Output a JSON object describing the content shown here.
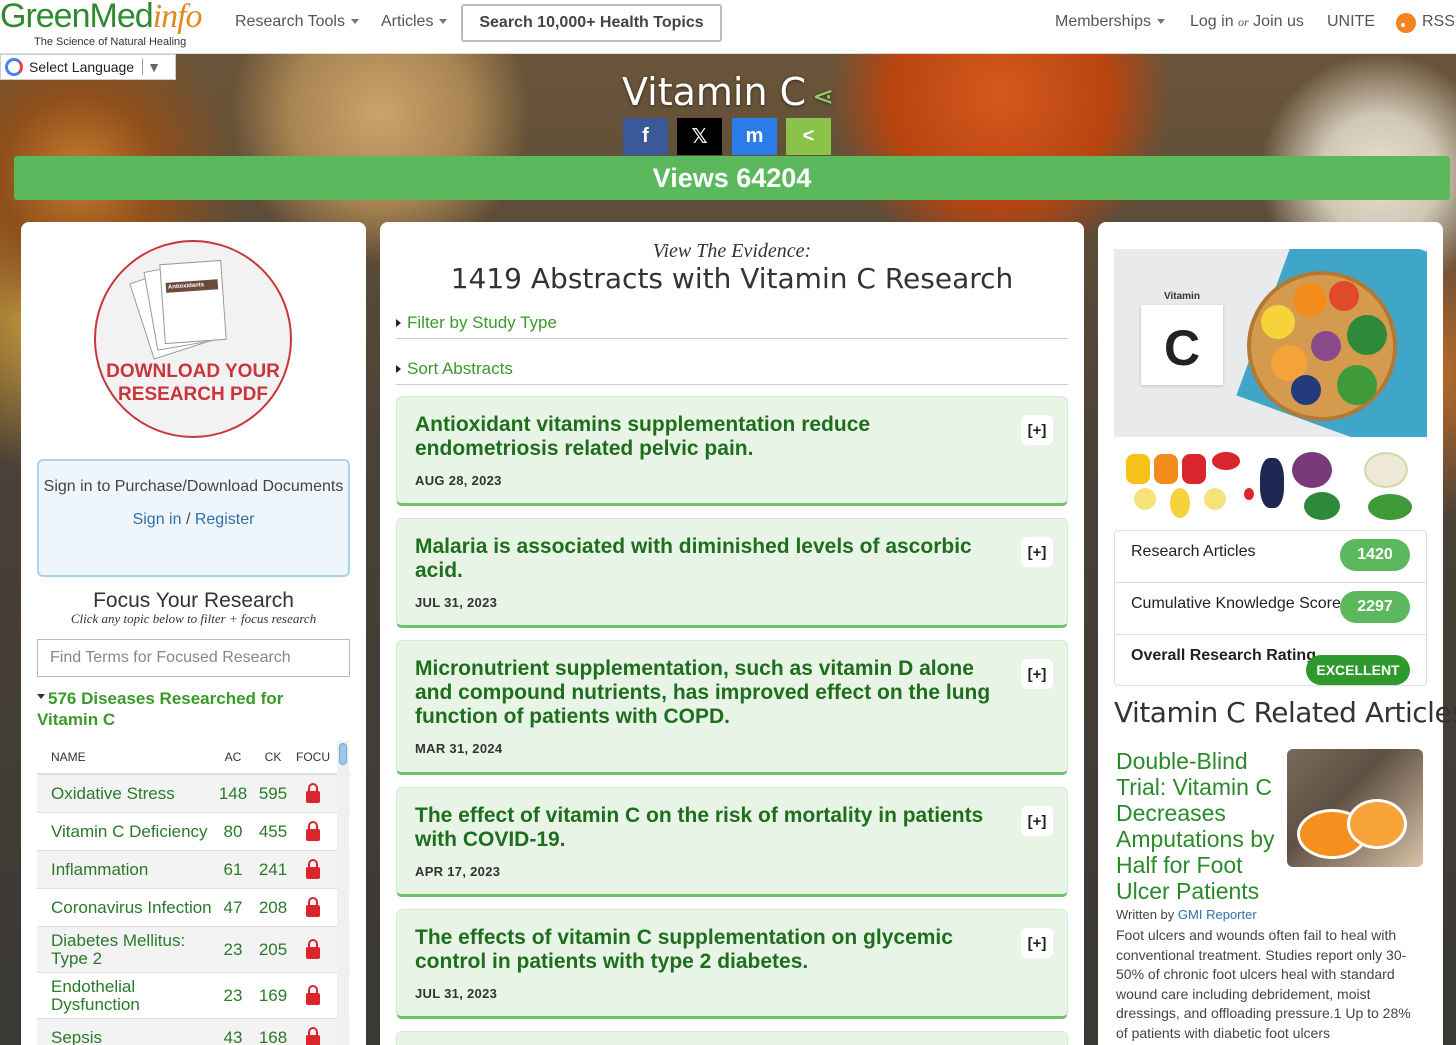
{
  "nav": {
    "logo_main": "GreenMed",
    "logo_accent": "info",
    "logo_tagline": "The Science of Natural Healing",
    "research_tools": "Research Tools",
    "articles": "Articles",
    "search": "Search 10,000+ Health Topics",
    "memberships": "Memberships",
    "login": "Log in",
    "or": "or",
    "join": "Join us",
    "unite": "UNITE",
    "rss": "RSS"
  },
  "language": {
    "label": "Select Language"
  },
  "hero": {
    "title": "Vitamin C",
    "social": [
      "f",
      "𝕏",
      "m",
      "<"
    ],
    "views": "Views 64204"
  },
  "left": {
    "pdf_line1": "DOWNLOAD YOUR",
    "pdf_line2": "RESEARCH PDF",
    "doc_text": "Antioxidants",
    "signin_text": "Sign in to Purchase/Download Documents",
    "signin_link": "Sign in",
    "register_link": "Register",
    "focus_title": "Focus Your Research",
    "focus_sub": "Click any topic below to filter + focus research",
    "find_placeholder": "Find Terms for Focused Research",
    "disease_heading": "576 Diseases Researched for Vitamin C",
    "table_headers": {
      "name": "NAME",
      "ac": "AC",
      "ck": "CK",
      "focus": "FOCU"
    },
    "rows": [
      {
        "name": "Oxidative Stress",
        "ac": "148",
        "ck": "595"
      },
      {
        "name": "Vitamin C Deficiency",
        "ac": "80",
        "ck": "455"
      },
      {
        "name": "Inflammation",
        "ac": "61",
        "ck": "241"
      },
      {
        "name": "Coronavirus Infection",
        "ac": "47",
        "ck": "208"
      },
      {
        "name": "Diabetes Mellitus: Type 2",
        "ac": "23",
        "ck": "205"
      },
      {
        "name": "Endothelial Dysfunction",
        "ac": "23",
        "ck": "169"
      },
      {
        "name": "Sepsis",
        "ac": "43",
        "ck": "168"
      }
    ]
  },
  "center": {
    "evidence_label": "View The Evidence:",
    "evidence_title": "1419 Abstracts with Vitamin C Research",
    "filter": "Filter by Study Type",
    "sort": "Sort Abstracts",
    "expand": "[+]",
    "abstracts": [
      {
        "title": "Antioxidant vitamins supplementation reduce endometriosis related pelvic pain.",
        "date": "AUG 28, 2023"
      },
      {
        "title": "Malaria is associated with diminished levels of ascorbic acid.",
        "date": "JUL 31, 2023"
      },
      {
        "title": "Micronutrient supplementation, such as vitamin D alone and compound nutrients, has improved effect on the lung function of patients with COPD.",
        "date": "MAR 31, 2024"
      },
      {
        "title": "The effect of vitamin C on the risk of mortality in patients with COVID-19.",
        "date": "APR 17, 2023"
      },
      {
        "title": "The effects of vitamin C supplementation on glycemic control in patients with type 2 diabetes.",
        "date": "JUL 31, 2023"
      }
    ]
  },
  "right": {
    "card_label": "Vitamin",
    "card_letter": "C",
    "stats": [
      {
        "label": "Research Articles",
        "value": "1420"
      },
      {
        "label": "Cumulative Knowledge Score",
        "value": "2297"
      },
      {
        "label": "Overall Research Rating",
        "value": "EXCELLENT"
      }
    ],
    "related_title": "Vitamin C Related Articles",
    "article_title": "Double-Blind Trial: Vitamin C Decreases Amputations by Half for Foot Ulcer Patients",
    "written_by": "Written by",
    "author": "GMI Reporter",
    "article_body": "Foot ulcers and wounds often fail to heal with conventional treatment. Studies report only 30-50% of chronic foot ulcers heal with standard wound care including debridement, moist dressings, and offloading pressure.1 Up to 28% of patients with diabetic foot ulcers"
  },
  "colors": {
    "green": "#5cb85c",
    "dark_green": "#1e6e1e",
    "pdf_red": "#c9353a",
    "link_blue": "#3071a9"
  }
}
